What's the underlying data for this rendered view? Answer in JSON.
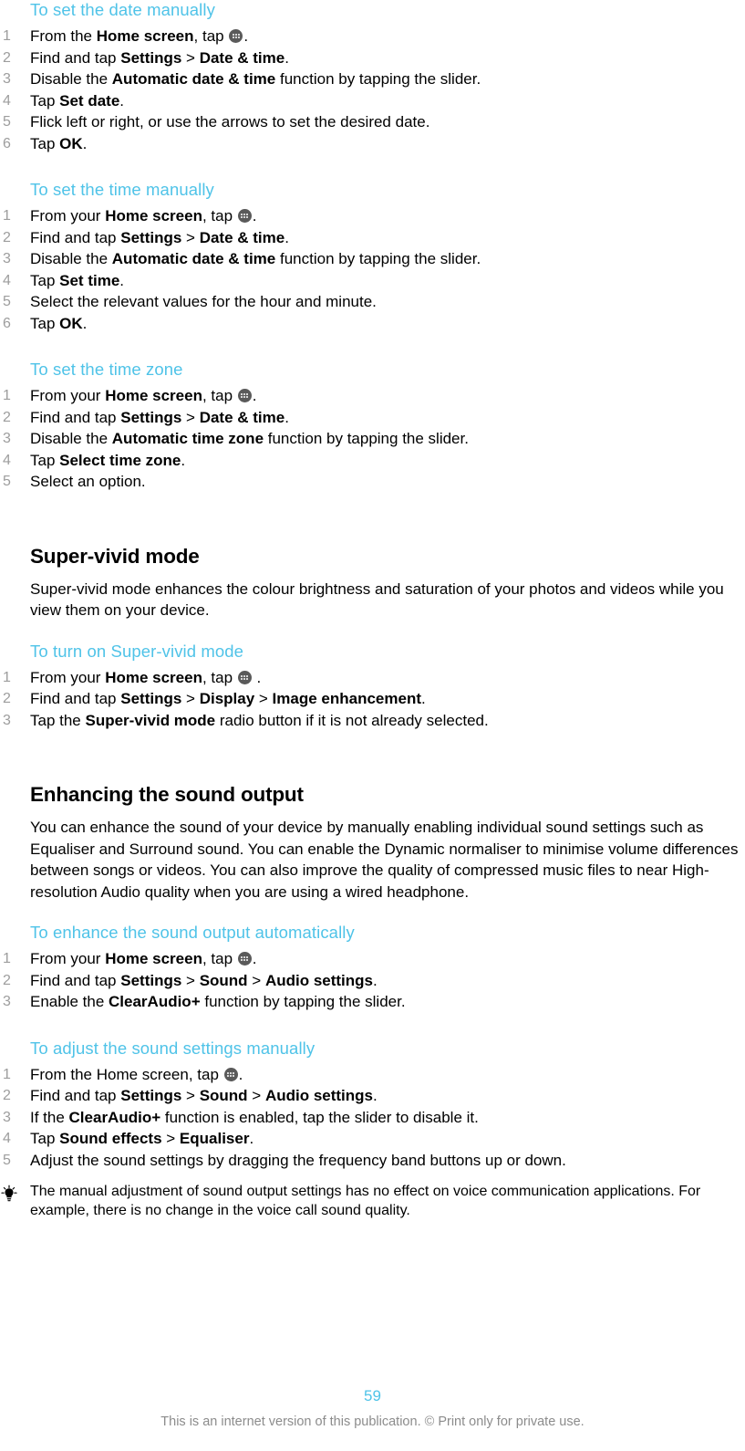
{
  "document": {
    "page_number": "59",
    "footer_note": "This is an internet version of this publication. © Print only for private use.",
    "heading_color": "#4FC3E8",
    "body_color": "#000000",
    "number_color": "#9d9d9d",
    "footer_color": "#8c8c8c"
  },
  "procedures": {
    "set_date": {
      "title": "To set the date manually",
      "steps": [
        {
          "pre": "From the ",
          "bold1": "Home screen",
          "mid": ", tap ",
          "icon": "app-drawer-icon",
          "post": "."
        },
        {
          "pre": "Find and tap ",
          "bold1": "Settings",
          "sep": " > ",
          "bold2": "Date & time",
          "post": "."
        },
        {
          "pre": "Disable the ",
          "bold1": "Automatic date & time",
          "post": " function by tapping the slider."
        },
        {
          "pre": "Tap ",
          "bold1": "Set date",
          "post": "."
        },
        {
          "pre": "Flick left or right, or use the arrows to set the desired date."
        },
        {
          "pre": "Tap ",
          "bold1": "OK",
          "post": "."
        }
      ]
    },
    "set_time": {
      "title": "To set the time manually",
      "steps": [
        {
          "pre": "From your ",
          "bold1": "Home screen",
          "mid": ", tap ",
          "icon": "app-drawer-icon",
          "post": "."
        },
        {
          "pre": "Find and tap ",
          "bold1": "Settings",
          "sep": " > ",
          "bold2": "Date & time",
          "post": "."
        },
        {
          "pre": "Disable the ",
          "bold1": "Automatic date & time",
          "post": " function by tapping the slider."
        },
        {
          "pre": "Tap ",
          "bold1": "Set time",
          "post": "."
        },
        {
          "pre": "Select the relevant values for the hour and minute."
        },
        {
          "pre": "Tap ",
          "bold1": "OK",
          "post": "."
        }
      ]
    },
    "set_time_zone": {
      "title": "To set the time zone",
      "steps": [
        {
          "pre": "From your ",
          "bold1": "Home screen",
          "mid": ", tap ",
          "icon": "app-drawer-icon",
          "post": "."
        },
        {
          "pre": "Find and tap ",
          "bold1": "Settings",
          "sep": " > ",
          "bold2": "Date & time",
          "post": "."
        },
        {
          "pre": "Disable the ",
          "bold1": "Automatic time zone",
          "post": " function by tapping the slider."
        },
        {
          "pre": "Tap ",
          "bold1": "Select time zone",
          "post": "."
        },
        {
          "pre": "Select an option."
        }
      ]
    },
    "turn_on_super_vivid": {
      "title": "To turn on Super-vivid mode",
      "steps": [
        {
          "pre": "From your ",
          "bold1": "Home screen",
          "mid": ", tap ",
          "icon": "app-drawer-icon",
          "post": " ."
        },
        {
          "pre": "Find and tap ",
          "bold1": "Settings",
          "sep": " > ",
          "bold2": "Display",
          "sep2": " > ",
          "bold3": "Image enhancement",
          "post": "."
        },
        {
          "pre": "Tap the ",
          "bold1": "Super-vivid mode",
          "post": " radio button if it is not already selected."
        }
      ]
    },
    "enhance_sound_auto": {
      "title": "To enhance the sound output automatically",
      "steps": [
        {
          "pre": "From your ",
          "bold1": "Home screen",
          "mid": ", tap ",
          "icon": "app-drawer-icon",
          "post": "."
        },
        {
          "pre": "Find and tap ",
          "bold1": "Settings",
          "sep": " > ",
          "bold2": "Sound",
          "sep2": " > ",
          "bold3": "Audio settings",
          "post": "."
        },
        {
          "pre": "Enable the ",
          "bold1": "ClearAudio+",
          "post": " function by tapping the slider."
        }
      ]
    },
    "adjust_sound_manual": {
      "title": "To adjust the sound settings manually",
      "steps": [
        {
          "pre": "From the Home screen, tap ",
          "icon": "app-drawer-icon",
          "post": "."
        },
        {
          "pre": "Find and tap ",
          "bold1": "Settings",
          "sep": " > ",
          "bold2": "Sound",
          "sep2": " > ",
          "bold3": "Audio settings",
          "post": "."
        },
        {
          "pre": "If the ",
          "bold1": "ClearAudio+",
          "post": " function is enabled, tap the slider to disable it."
        },
        {
          "pre": "Tap ",
          "bold1": "Sound effects",
          "sep": " > ",
          "bold2": "Equaliser",
          "post": "."
        },
        {
          "pre": "Adjust the sound settings by dragging the frequency band buttons up or down."
        }
      ],
      "tip": "The manual adjustment of sound output settings has no effect on voice communication applications. For example, there is no change in the voice call sound quality."
    }
  },
  "sections": {
    "super_vivid": {
      "title": "Super-vivid mode",
      "body": "Super-vivid mode enhances the colour brightness and saturation of your photos and videos while you view them on your device."
    },
    "enhancing_sound": {
      "title": "Enhancing the sound output",
      "body": "You can enhance the sound of your device by manually enabling individual sound settings such as Equaliser and Surround sound. You can enable the Dynamic normaliser to minimise volume differences between songs or videos. You can also improve the quality of compressed music files to near High-resolution Audio quality when you are using a wired headphone."
    }
  }
}
